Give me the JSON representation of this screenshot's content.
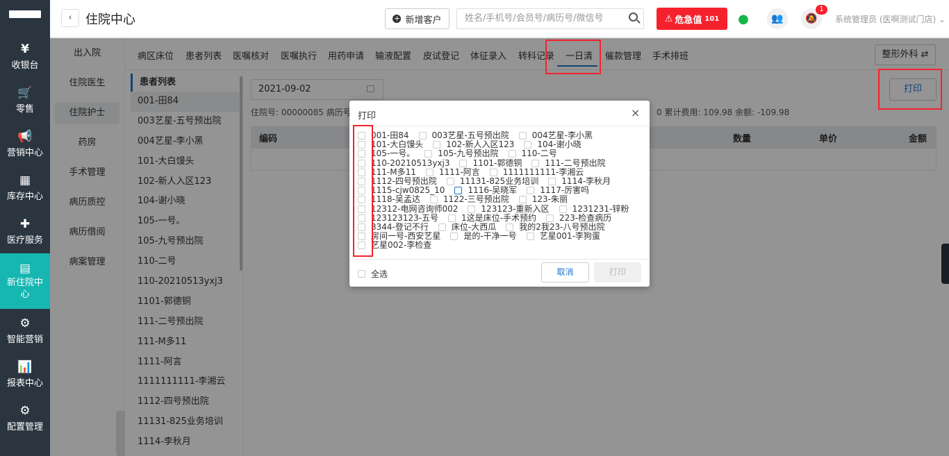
{
  "nav": [
    {
      "icon": "¥",
      "label": "收银台"
    },
    {
      "icon": "🛒",
      "label": "零售"
    },
    {
      "icon": "📢",
      "label": "营销中心"
    },
    {
      "icon": "▦",
      "label": "库存中心"
    },
    {
      "icon": "✚",
      "label": "医疗服务"
    },
    {
      "icon": "▤",
      "label": "新住院中心"
    },
    {
      "icon": "⚙",
      "label": "智能营销"
    },
    {
      "icon": "📊",
      "label": "报表中心"
    },
    {
      "icon": "⚙",
      "label": "配置管理"
    }
  ],
  "header": {
    "back": "‹",
    "title": "住院中心",
    "new_customer": "新增客户",
    "search_placeholder": "姓名/手机号/会员号/病历号/微信号",
    "danger_label": "危急值",
    "danger_count": "101",
    "notif_count": "1",
    "user": "系统管理员 (医啊测试门店)"
  },
  "subnav": [
    "出入院",
    "住院医生",
    "住院护士",
    "药房",
    "手术管理",
    "病历质控",
    "病历借阅",
    "病案管理"
  ],
  "tabs": [
    "病区床位",
    "患者列表",
    "医嘱核对",
    "医嘱执行",
    "用药申请",
    "输液配置",
    "皮试登记",
    "体征录入",
    "转科记录",
    "一日清",
    "催款管理",
    "手术排班"
  ],
  "dept": "整形外科",
  "patient_list": {
    "title": "患者列表",
    "items": [
      "001-田84",
      "003艺星-五号预出院",
      "004艺星-李小黑",
      "101-大白馒头",
      "102-新人入区123",
      "104-谢小晓",
      "105-一号。",
      "105-九号预出院",
      "110-二号",
      "110-20210513yxj3",
      "1101-郭德铜",
      "111-二号预出院",
      "111-M多11",
      "1111-阿言",
      "1111111111-李湘云",
      "1112-四号预出院",
      "11131-825业务培训",
      "1114-李秋月"
    ]
  },
  "main": {
    "date": "2021-09-02",
    "info_left": "住院号: 00000085   病历号",
    "info_right": "0   累计费用: 109.98   余额: -109.98",
    "print": "打印",
    "columns": {
      "code": "编码",
      "qty": "数量",
      "price": "单价",
      "amount": "金额"
    }
  },
  "dialog": {
    "title": "打印",
    "close": "×",
    "rows": [
      [
        "001-田84",
        "003艺星-五号预出院",
        "004艺星-李小黑"
      ],
      [
        "101-大白馒头",
        "102-新人入区123",
        "104-谢小晓"
      ],
      [
        "105-一号。",
        "105-九号预出院",
        "110-二号"
      ],
      [
        "110-20210513yxj3",
        "1101-郭德铜",
        "111-二号预出院"
      ],
      [
        "111-M多11",
        "1111-阿言",
        "1111111111-李湘云"
      ],
      [
        "1112-四号预出院",
        "11131-825业务培训",
        "1114-李秋月"
      ],
      [
        "1115-cjw0825_10",
        "1116-吴晓军",
        "1117-厉害吗"
      ],
      [
        "1118-吴孟达",
        "1122-三号预出院",
        "123-朱丽"
      ],
      [
        "12312-电网咨询师002",
        "123123-重新入区",
        "1231231-锌粉"
      ],
      [
        "123123123-五号",
        "1这是床位-手术预约",
        "223-检查病历"
      ],
      [
        "3344-登记不行",
        "床位-大西瓜",
        "我的2我23-八号预出院"
      ],
      [
        "房间一号-西安艺星",
        "是的-干净一号",
        "艺星001-李狗蛋"
      ],
      [
        "艺星002-李检查"
      ]
    ],
    "select_all": "全选",
    "cancel": "取消",
    "ok": "打印"
  }
}
